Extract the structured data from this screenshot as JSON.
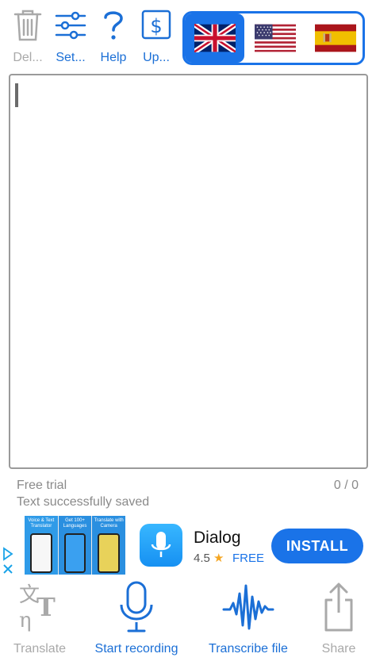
{
  "toolbar": {
    "delete_label": "Del...",
    "settings_label": "Set...",
    "help_label": "Help",
    "upgrade_label": "Up..."
  },
  "languages": {
    "items": [
      "UK English",
      "US English",
      "Spanish"
    ],
    "selected": "UK English"
  },
  "status": {
    "plan": "Free trial",
    "message": "Text successfully saved",
    "counter": "0 / 0"
  },
  "ad": {
    "app_name": "Dialog",
    "rating": "4.5",
    "price": "FREE",
    "install_label": "INSTALL",
    "screens": [
      "Voice & Text Translator",
      "Get 100+ Languages",
      "Translate with Camera"
    ]
  },
  "bottom": {
    "translate_label": "Translate",
    "record_label": "Start recording",
    "transcribe_label": "Transcribe file",
    "share_label": "Share"
  },
  "colors": {
    "accent": "#1a73e8",
    "inactive": "#a9a9a9"
  }
}
